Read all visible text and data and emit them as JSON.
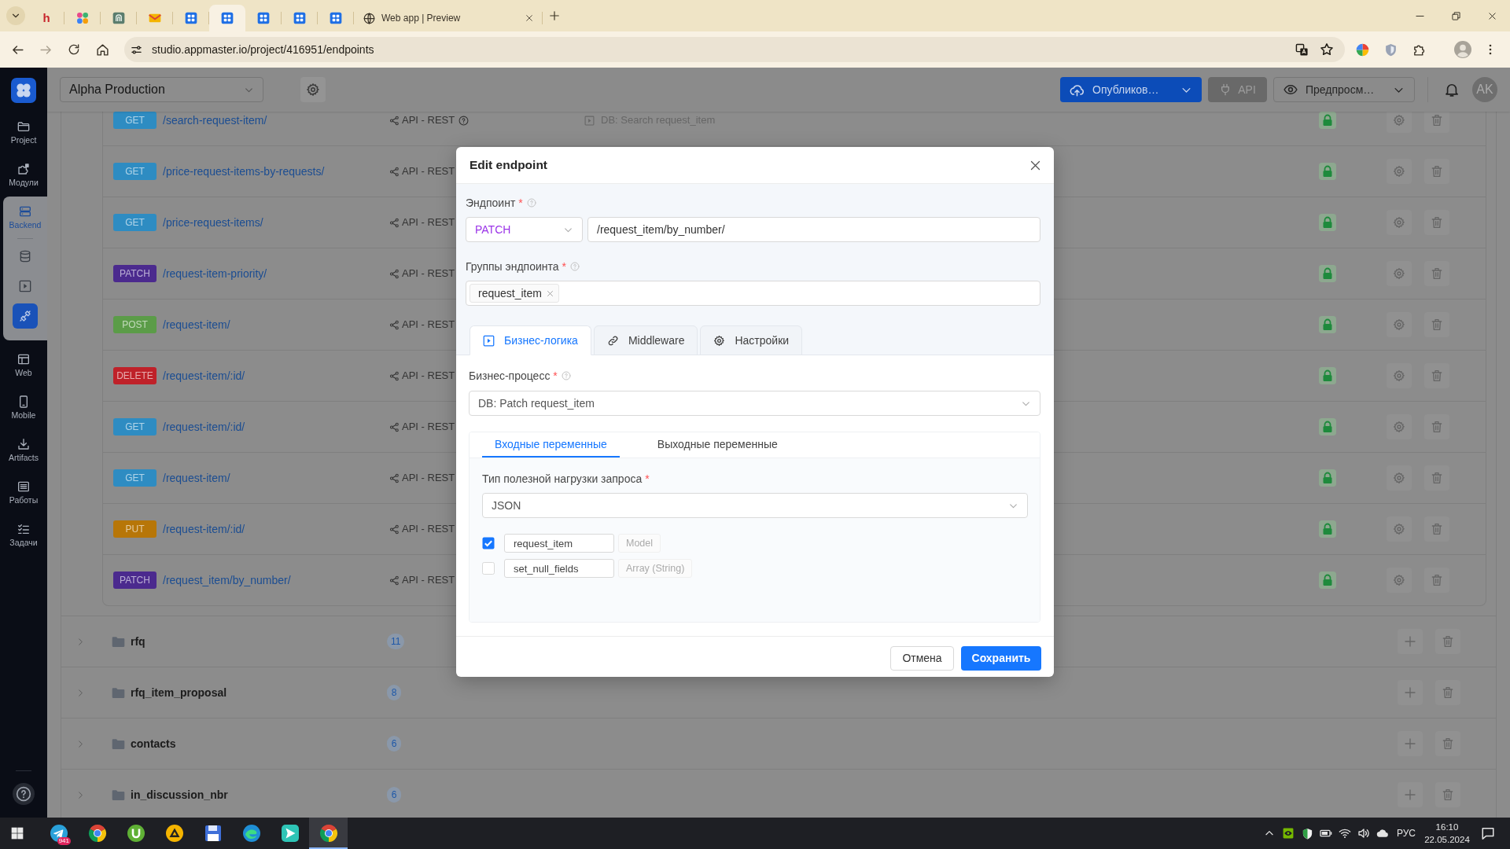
{
  "browser": {
    "tabs": [
      {
        "kind": "letter",
        "glyph": "h",
        "selected": false
      },
      {
        "kind": "dots",
        "selected": false
      },
      {
        "kind": "badge",
        "selected": false
      },
      {
        "kind": "mail",
        "selected": false
      },
      {
        "kind": "grid",
        "selected": false
      },
      {
        "kind": "grid",
        "selected": true
      },
      {
        "kind": "grid",
        "selected": false
      },
      {
        "kind": "grid",
        "selected": false
      },
      {
        "kind": "grid",
        "selected": false
      },
      {
        "kind": "page",
        "title": "Web app | Preview",
        "selected": false
      }
    ],
    "forward_button": {
      "disabled": true
    },
    "url": "studio.appmaster.io/project/416951/endpoints"
  },
  "sidebar": {
    "items": [
      {
        "kind": "folder",
        "label": "Project",
        "selected": false
      },
      {
        "kind": "modules",
        "label": "Модули",
        "selected": false
      },
      {
        "kind": "backend",
        "label": "Backend",
        "selected": true,
        "children": [
          {
            "kind": "database",
            "selected": false
          },
          {
            "kind": "process",
            "selected": false
          },
          {
            "kind": "endpoints",
            "selected": true
          }
        ]
      },
      {
        "kind": "web",
        "label": "Web",
        "selected": false
      },
      {
        "kind": "mobile",
        "label": "Mobile",
        "selected": false
      },
      {
        "kind": "artifacts",
        "label": "Artifacts",
        "selected": false
      },
      {
        "kind": "jobs",
        "label": "Работы",
        "selected": false
      },
      {
        "kind": "tasks",
        "label": "Задачи",
        "selected": false
      }
    ]
  },
  "header": {
    "project": "Alpha Production",
    "publish_button": "Опубликов…",
    "api_button": {
      "label": "API",
      "disabled": true
    },
    "preview_button": "Предпросм…",
    "avatar": "AK"
  },
  "endpoints": [
    {
      "method": "GET",
      "color": "#2e8cc2",
      "path": "/search-request-item/",
      "api": "API - REST",
      "help": true,
      "process": "DB: Search request_item"
    },
    {
      "method": "GET",
      "color": "#2e8cc2",
      "path": "/price-request-items-by-requests/",
      "api": "API - REST"
    },
    {
      "method": "GET",
      "color": "#2e8cc2",
      "path": "/price-request-items/",
      "api": "API - REST"
    },
    {
      "method": "PATCH",
      "color": "#4b2a8e",
      "path": "/request-item-priority/",
      "api": "API - REST"
    },
    {
      "method": "POST",
      "color": "#5b9c48",
      "path": "/request-item/",
      "api": "API - REST"
    },
    {
      "method": "DELETE",
      "color": "#bf2129",
      "path": "/request-item/:id/",
      "api": "API - REST"
    },
    {
      "method": "GET",
      "color": "#2e8cc2",
      "path": "/request-item/:id/",
      "api": "API - REST"
    },
    {
      "method": "GET",
      "color": "#2e8cc2",
      "path": "/request-item/",
      "api": "API - REST"
    },
    {
      "method": "PUT",
      "color": "#b77608",
      "path": "/request-item/:id/",
      "api": "API - REST"
    },
    {
      "method": "PATCH",
      "color": "#4b2a8e",
      "path": "/request_item/by_number/",
      "api": "API - REST"
    }
  ],
  "groups": [
    {
      "name": "rfq",
      "count": "11",
      "expanded": false
    },
    {
      "name": "rfq_item_proposal",
      "count": "8",
      "expanded": false
    },
    {
      "name": "contacts",
      "count": "6",
      "expanded": false
    },
    {
      "name": "in_discussion_nbr",
      "count": "6",
      "expanded": false
    }
  ],
  "modal": {
    "title": "Edit endpoint",
    "endpoint_label": {
      "text": "Эндпоинт",
      "required_mark": "*",
      "help": true
    },
    "method": "PATCH",
    "path": "/request_item/by_number/",
    "groups_label": {
      "text": "Группы эндпоинта",
      "required_mark": "*",
      "help": true
    },
    "groups": [
      "request_item"
    ],
    "tabs": [
      {
        "kind": "logic",
        "label": "Бизнес-логика",
        "selected": true
      },
      {
        "kind": "middleware",
        "label": "Middleware",
        "selected": false
      },
      {
        "kind": "settings",
        "label": "Настройки",
        "selected": false
      }
    ],
    "process_label": {
      "text": "Бизнес-процесс",
      "required_mark": "*",
      "help": true
    },
    "process": "DB: Patch request_item",
    "variable_tabs": [
      {
        "label": "Входные переменные",
        "selected": true
      },
      {
        "label": "Выходные переменные",
        "selected": false
      }
    ],
    "payload_label": {
      "text": "Тип полезной нагрузки запроса",
      "required_mark": "*"
    },
    "payload_type": "JSON",
    "variables": [
      {
        "name": "request_item",
        "type": "Model",
        "checked": true
      },
      {
        "name": "set_null_fields",
        "type": "Array (String)",
        "checked": false
      }
    ],
    "cancel_button": "Отмена",
    "save_button": "Сохранить"
  },
  "taskbar": {
    "apps": [
      {
        "kind": "telegram",
        "badge": "941",
        "selected": false
      },
      {
        "kind": "chrome",
        "selected": false
      },
      {
        "kind": "torrent",
        "selected": false
      },
      {
        "kind": "player",
        "selected": false
      },
      {
        "kind": "disk",
        "selected": false
      },
      {
        "kind": "edge",
        "selected": false
      },
      {
        "kind": "send",
        "selected": false
      },
      {
        "kind": "chrome",
        "selected": true
      }
    ],
    "language": "РУС",
    "time": "16:10",
    "date": "22.05.2024"
  }
}
